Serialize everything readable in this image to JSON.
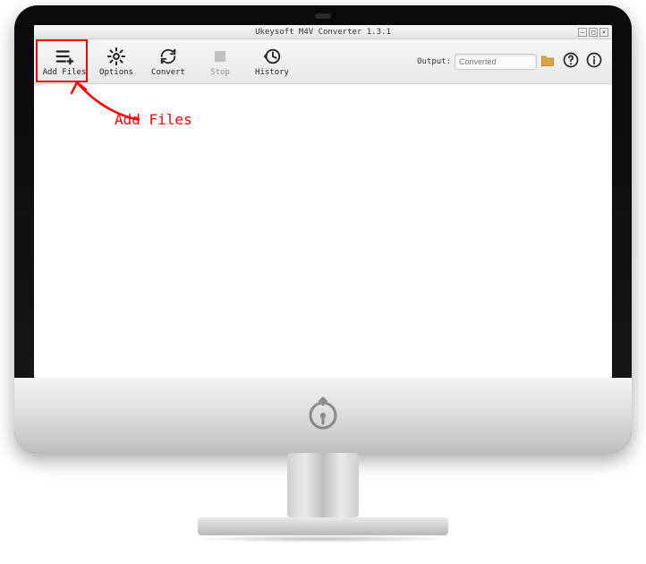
{
  "app": {
    "title": "Ukeysoft M4V Converter 1.3.1"
  },
  "toolbar": {
    "add_files": {
      "label": "Add Files"
    },
    "options": {
      "label": "Options"
    },
    "convert": {
      "label": "Convert"
    },
    "stop": {
      "label": "Stop"
    },
    "history": {
      "label": "History"
    }
  },
  "output": {
    "label": "Output:",
    "placeholder": "Converted"
  },
  "annotation": {
    "text": "Add Files"
  },
  "window_controls": {
    "minimize": "‒",
    "maximize": "□",
    "close": "×"
  }
}
